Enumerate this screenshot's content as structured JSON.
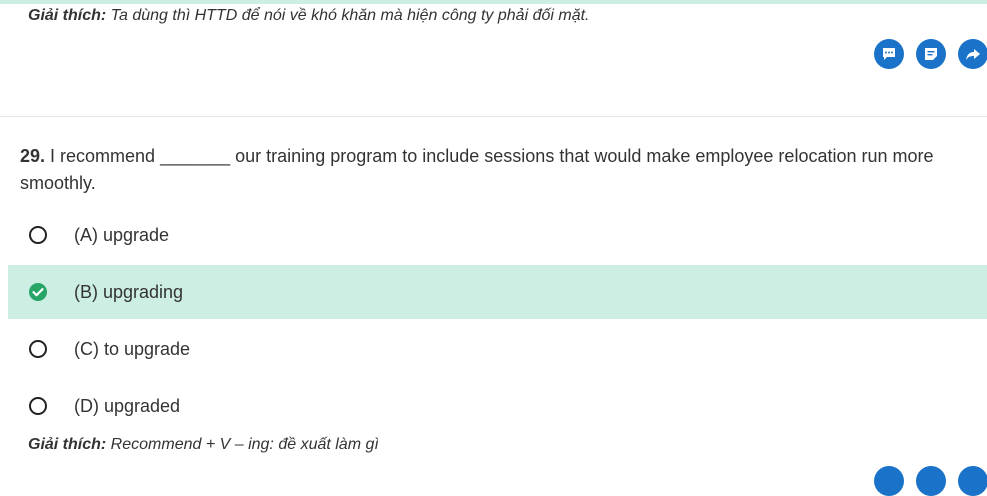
{
  "prev_explanation": {
    "label": "Giải thích:",
    "text": " Ta dùng thì HTTD để nói về khó khăn mà hiện công ty phải đối mặt."
  },
  "action_icons": [
    "comment-icon",
    "note-icon",
    "share-icon"
  ],
  "question": {
    "number": "29.",
    "text": " I recommend _______ our training program to include sessions that would make employee relocation run more smoothly."
  },
  "options": [
    {
      "label": "(A) upgrade",
      "selected": false
    },
    {
      "label": "(B) upgrading",
      "selected": true
    },
    {
      "label": "(C) to upgrade",
      "selected": false
    },
    {
      "label": "(D) upgraded",
      "selected": false
    }
  ],
  "explanation": {
    "label": "Giải thích:",
    "text": " Recommend + V – ing: đề xuất làm gì"
  },
  "colors": {
    "accent_blue": "#1a73c9",
    "correct_green": "#27a567",
    "selected_bg": "#cdeee3"
  }
}
